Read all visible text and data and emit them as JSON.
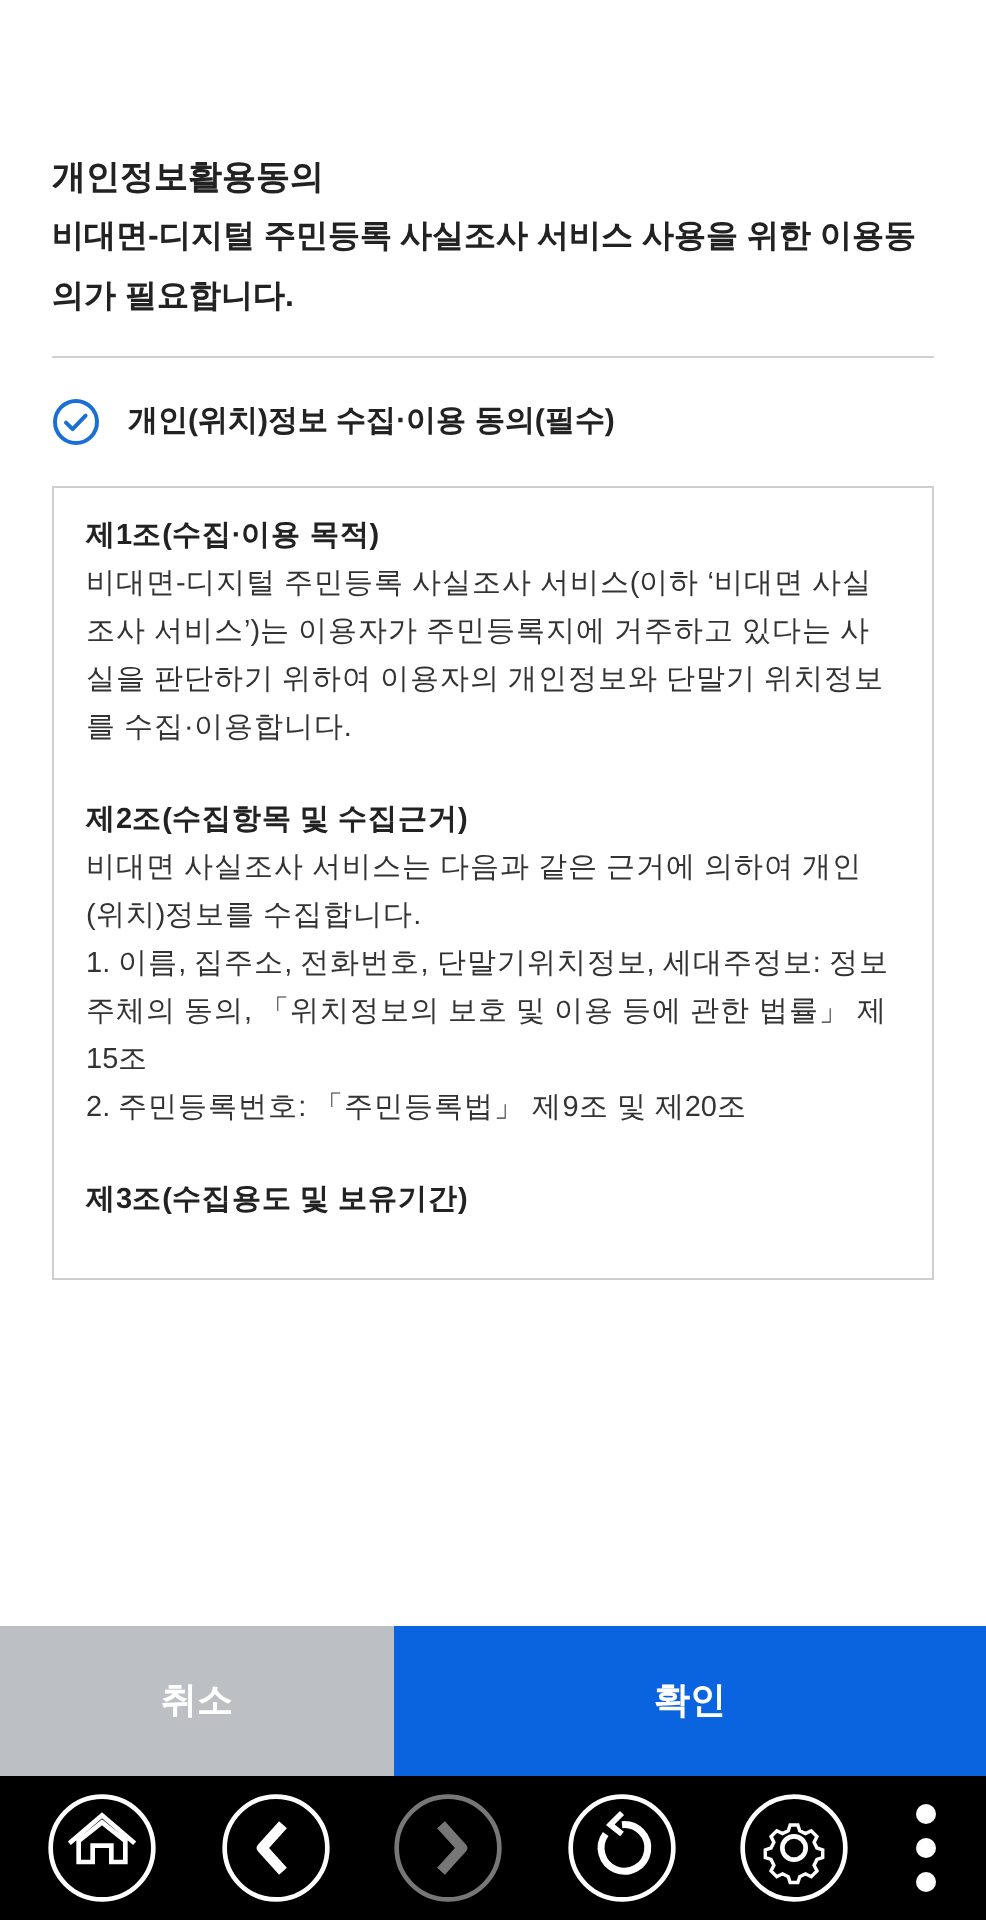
{
  "title": "개인정보활용동의",
  "subtitle": "비대면-디지털 주민등록 사실조사 서비스 사용을 위한 이용동의가 필요합니다.",
  "consent": {
    "label": "개인(위치)정보 수집·이용 동의(필수)",
    "checked": true
  },
  "terms": [
    {
      "heading": "제1조(수집·이용 목적)",
      "paragraphs": [
        "비대면-디지털 주민등록 사실조사 서비스(이하 ‘비대면 사실조사 서비스’)는 이용자가 주민등록지에 거주하고 있다는 사실을 판단하기 위하여 이용자의 개인정보와 단말기 위치정보를 수집·이용합니다."
      ]
    },
    {
      "heading": "제2조(수집항목 및 수집근거)",
      "paragraphs": [
        "비대면 사실조사 서비스는 다음과 같은 근거에 의하여 개인(위치)정보를 수집합니다.",
        "1. 이름, 집주소, 전화번호, 단말기위치정보, 세대주정보: 정보주체의 동의, 「위치정보의 보호 및 이용 등에 관한 법률」 제15조",
        "2. 주민등록번호: 「주민등록법」 제9조 및 제20조"
      ]
    },
    {
      "heading": "제3조(수집용도 및 보유기간)"
    }
  ],
  "buttons": [
    {
      "label": "취소",
      "kind": "cancel"
    },
    {
      "label": "확인",
      "kind": "confirm"
    }
  ],
  "nav": [
    {
      "kind": "home",
      "disabled": false
    },
    {
      "kind": "back",
      "disabled": false
    },
    {
      "kind": "forward",
      "disabled": true
    },
    {
      "kind": "refresh",
      "disabled": false
    },
    {
      "kind": "settings",
      "disabled": false
    },
    {
      "kind": "more",
      "disabled": false
    }
  ]
}
